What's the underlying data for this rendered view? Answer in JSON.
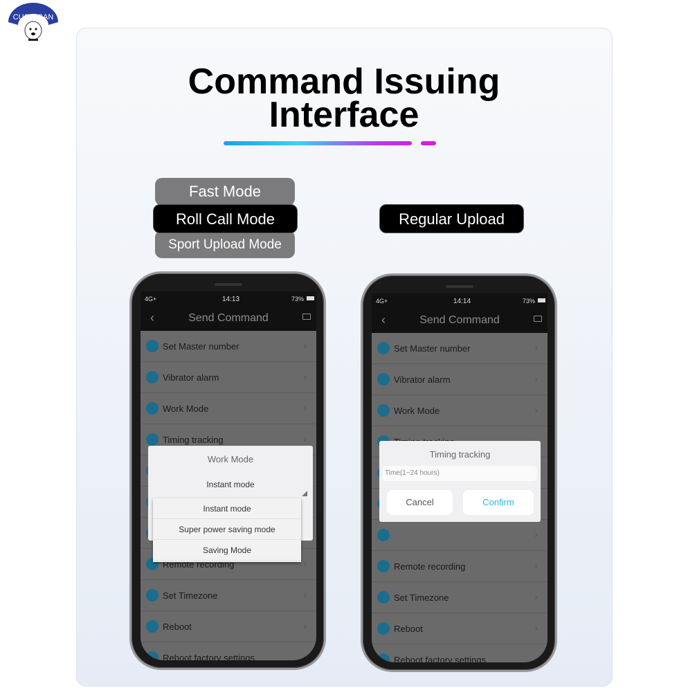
{
  "brand": {
    "logo_text": "CUCO CAN"
  },
  "title": {
    "line1": "Command Issuing",
    "line2": "Interface"
  },
  "modes": {
    "fast": "Fast Mode",
    "roll_call": "Roll Call Mode",
    "sport": "Sport Upload Mode",
    "regular": "Regular Upload"
  },
  "colors": {
    "accent": "#1aa0e8",
    "magenta": "#d41fd8",
    "confirm": "#2fb6e0",
    "icon": "#1b6d8d"
  },
  "phone_left": {
    "status": {
      "network": "4G+",
      "time": "14:13",
      "battery": "73%"
    },
    "header": {
      "title": "Send Command"
    },
    "rows": [
      "Set Master number",
      "Vibrator alarm",
      "Work Mode",
      "Timing tracking",
      "",
      "",
      "",
      "Remote recording",
      "Set Timezone",
      "Reboot",
      "Reboot factory settings"
    ],
    "dialog": {
      "title": "Work Mode",
      "selected": "Instant mode",
      "options": [
        "Instant mode",
        "Super power saving mode",
        "Saving Mode"
      ]
    }
  },
  "phone_right": {
    "status": {
      "network": "4G+",
      "time": "14:14",
      "battery": "73%"
    },
    "header": {
      "title": "Send Command"
    },
    "rows": [
      "Set Master number",
      "Vibrator alarm",
      "Work Mode",
      "Timing tracking",
      "",
      "",
      "",
      "Remote recording",
      "Set Timezone",
      "Reboot",
      "Reboot factory settings"
    ],
    "dialog": {
      "title": "Timing tracking",
      "placeholder": "Time(1~24 hours)",
      "cancel": "Cancel",
      "confirm": "Confirm"
    }
  }
}
